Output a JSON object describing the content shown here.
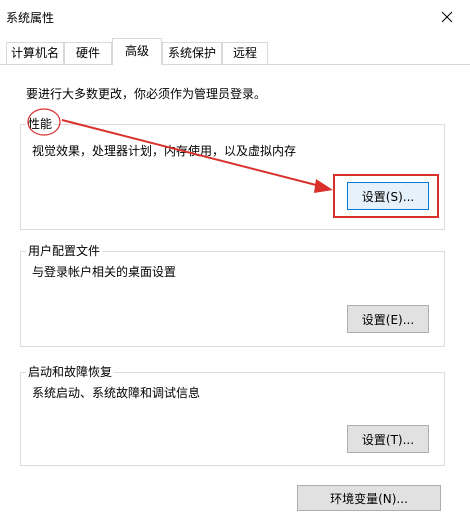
{
  "window": {
    "title": "系统属性",
    "close_icon": "close-icon"
  },
  "tabs": [
    {
      "label": "计算机名",
      "active": false
    },
    {
      "label": "硬件",
      "active": false
    },
    {
      "label": "高级",
      "active": true
    },
    {
      "label": "系统保护",
      "active": false
    },
    {
      "label": "远程",
      "active": false
    }
  ],
  "notice": "要进行大多数更改，你必须作为管理员登录。",
  "performance": {
    "label": "性能",
    "description": "视觉效果，处理器计划，内存使用，以及虚拟内存",
    "button": "设置(S)..."
  },
  "user_profile": {
    "label": "用户配置文件",
    "description": "与登录帐户相关的桌面设置",
    "button": "设置(E)..."
  },
  "startup_recovery": {
    "label": "启动和故障恢复",
    "description": "系统启动、系统故障和调试信息",
    "button": "设置(T)..."
  },
  "env_button": "环境变量(N)...",
  "annotation_color": "#d9302c"
}
